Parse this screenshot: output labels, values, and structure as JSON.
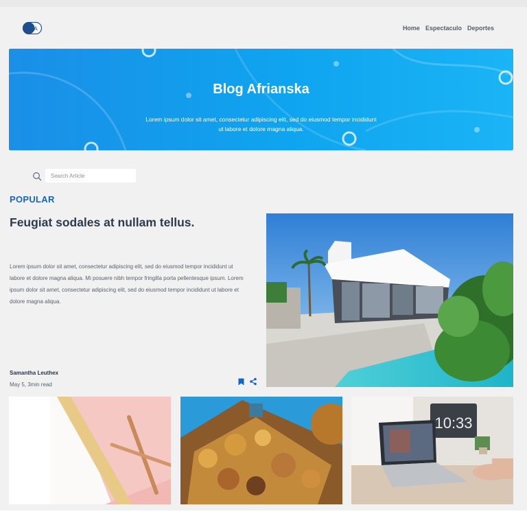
{
  "header": {
    "logo_letter": "A",
    "nav": [
      "Home",
      "Espectaculo",
      "Deportes"
    ]
  },
  "hero": {
    "title": "Blog Afrianska",
    "text": "Lorem ipsum dolor sit amet, consectetur adipiscing elit, sed do eiusmod tempor incididunt ut labore et dolore magna aliqua."
  },
  "search": {
    "placeholder": "Search Article",
    "icon": "search-icon"
  },
  "popular": {
    "label": "POPULAR",
    "title": "Feugiat sodales at nullam tellus.",
    "body": "Lorem ipsum dolor sit amet, consectetur adipiscing elit, sed do eiusmod tempor incididunt ut labore et dolore magna aliqua. Mi posuere nibh tempor fringilla porta pellentesque ipsum. Lorem ipsum dolor sit amet, consectetur adipiscing elit, sed do eiusmod tempor incididunt ut labore et dolore magna aliqua.",
    "author": "Samantha Leuthex",
    "meta": "May 5, 3min read",
    "actions": [
      "bookmark-icon",
      "share-icon"
    ]
  },
  "colors": {
    "accent": "#1565c0",
    "hero_start": "#1a8fe7",
    "hero_end": "#1bb4f6",
    "background": "#f1f1f1"
  }
}
